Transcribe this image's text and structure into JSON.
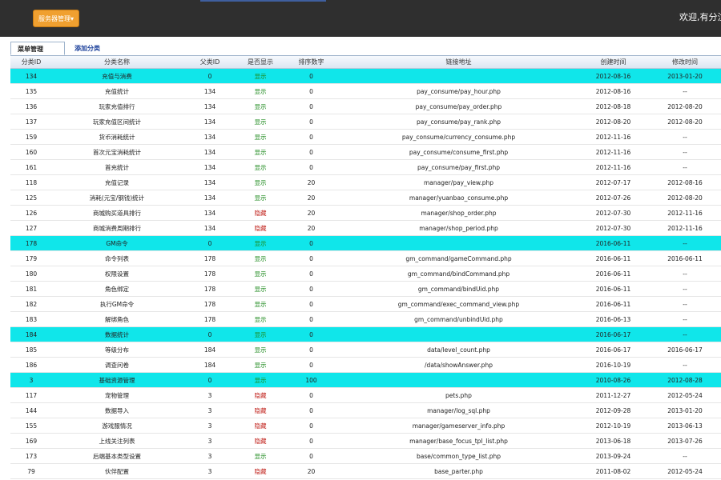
{
  "header": {
    "service_button": "服务器管理▾",
    "welcome": "欢迎,有分泣起"
  },
  "tabs": [
    {
      "label": "菜单管理"
    },
    {
      "label": "添加分类"
    }
  ],
  "columns": [
    "分类ID",
    "分类名称",
    "父类ID",
    "是否显示",
    "排序数字",
    "链接地址",
    "创建时间",
    "修改时间"
  ],
  "rows": [
    {
      "id": "134",
      "name": "充值与消费",
      "parent": "0",
      "visible": "显示",
      "sort": "0",
      "url": "",
      "created": "2012-08-16",
      "modified": "2013-01-20",
      "highlight": true
    },
    {
      "id": "135",
      "name": "充值统计",
      "parent": "134",
      "visible": "显示",
      "sort": "0",
      "url": "pay_consume/pay_hour.php",
      "created": "2012-08-16",
      "modified": "--",
      "highlight": false
    },
    {
      "id": "136",
      "name": "玩家充值排行",
      "parent": "134",
      "visible": "显示",
      "sort": "0",
      "url": "pay_consume/pay_order.php",
      "created": "2012-08-18",
      "modified": "2012-08-20",
      "highlight": false
    },
    {
      "id": "137",
      "name": "玩家充值区间统计",
      "parent": "134",
      "visible": "显示",
      "sort": "0",
      "url": "pay_consume/pay_rank.php",
      "created": "2012-08-20",
      "modified": "2012-08-20",
      "highlight": false
    },
    {
      "id": "159",
      "name": "货币消耗统计",
      "parent": "134",
      "visible": "显示",
      "sort": "0",
      "url": "pay_consume/currency_consume.php",
      "created": "2012-11-16",
      "modified": "--",
      "highlight": false
    },
    {
      "id": "160",
      "name": "首次元宝消耗统计",
      "parent": "134",
      "visible": "显示",
      "sort": "0",
      "url": "pay_consume/consume_first.php",
      "created": "2012-11-16",
      "modified": "--",
      "highlight": false
    },
    {
      "id": "161",
      "name": "首充统计",
      "parent": "134",
      "visible": "显示",
      "sort": "0",
      "url": "pay_consume/pay_first.php",
      "created": "2012-11-16",
      "modified": "--",
      "highlight": false
    },
    {
      "id": "118",
      "name": "充值记录",
      "parent": "134",
      "visible": "显示",
      "sort": "20",
      "url": "manager/pay_view.php",
      "created": "2012-07-17",
      "modified": "2012-08-16",
      "highlight": false
    },
    {
      "id": "125",
      "name": "消耗(元宝/钢钱)统计",
      "parent": "134",
      "visible": "显示",
      "sort": "20",
      "url": "manager/yuanbao_consume.php",
      "created": "2012-07-26",
      "modified": "2012-08-20",
      "highlight": false
    },
    {
      "id": "126",
      "name": "商城购买道具排行",
      "parent": "134",
      "visible": "隐藏",
      "sort": "20",
      "url": "manager/shop_order.php",
      "created": "2012-07-30",
      "modified": "2012-11-16",
      "highlight": false
    },
    {
      "id": "127",
      "name": "商城消费周期排行",
      "parent": "134",
      "visible": "隐藏",
      "sort": "20",
      "url": "manager/shop_period.php",
      "created": "2012-07-30",
      "modified": "2012-11-16",
      "highlight": false
    },
    {
      "id": "178",
      "name": "GM命令",
      "parent": "0",
      "visible": "显示",
      "sort": "0",
      "url": "",
      "created": "2016-06-11",
      "modified": "--",
      "highlight": true
    },
    {
      "id": "179",
      "name": "命令列表",
      "parent": "178",
      "visible": "显示",
      "sort": "0",
      "url": "gm_command/gameCommand.php",
      "created": "2016-06-11",
      "modified": "2016-06-11",
      "highlight": false
    },
    {
      "id": "180",
      "name": "权限设置",
      "parent": "178",
      "visible": "显示",
      "sort": "0",
      "url": "gm_command/bindCommand.php",
      "created": "2016-06-11",
      "modified": "--",
      "highlight": false
    },
    {
      "id": "181",
      "name": "角色绑定",
      "parent": "178",
      "visible": "显示",
      "sort": "0",
      "url": "gm_command/bindUid.php",
      "created": "2016-06-11",
      "modified": "--",
      "highlight": false
    },
    {
      "id": "182",
      "name": "执行GM命令",
      "parent": "178",
      "visible": "显示",
      "sort": "0",
      "url": "gm_command/exec_command_view.php",
      "created": "2016-06-11",
      "modified": "--",
      "highlight": false
    },
    {
      "id": "183",
      "name": "解绑角色",
      "parent": "178",
      "visible": "显示",
      "sort": "0",
      "url": "gm_command/unbindUid.php",
      "created": "2016-06-13",
      "modified": "--",
      "highlight": false
    },
    {
      "id": "184",
      "name": "数据统计",
      "parent": "0",
      "visible": "显示",
      "sort": "0",
      "url": "",
      "created": "2016-06-17",
      "modified": "--",
      "highlight": true
    },
    {
      "id": "185",
      "name": "等级分布",
      "parent": "184",
      "visible": "显示",
      "sort": "0",
      "url": "data/level_count.php",
      "created": "2016-06-17",
      "modified": "2016-06-17",
      "highlight": false
    },
    {
      "id": "186",
      "name": "调查问卷",
      "parent": "184",
      "visible": "显示",
      "sort": "0",
      "url": "/data/showAnswer.php",
      "created": "2016-10-19",
      "modified": "--",
      "highlight": false
    },
    {
      "id": "3",
      "name": "基础资源管理",
      "parent": "0",
      "visible": "显示",
      "sort": "100",
      "url": "",
      "created": "2010-08-26",
      "modified": "2012-08-28",
      "highlight": true
    },
    {
      "id": "117",
      "name": "宠物管理",
      "parent": "3",
      "visible": "隐藏",
      "sort": "0",
      "url": "pets.php",
      "created": "2011-12-27",
      "modified": "2012-05-24",
      "highlight": false
    },
    {
      "id": "144",
      "name": "数据导入",
      "parent": "3",
      "visible": "隐藏",
      "sort": "0",
      "url": "manager/log_sql.php",
      "created": "2012-09-28",
      "modified": "2013-01-20",
      "highlight": false
    },
    {
      "id": "155",
      "name": "游戏服情况",
      "parent": "3",
      "visible": "隐藏",
      "sort": "0",
      "url": "manager/gameserver_info.php",
      "created": "2012-10-19",
      "modified": "2013-06-13",
      "highlight": false
    },
    {
      "id": "169",
      "name": "上线关注列表",
      "parent": "3",
      "visible": "隐藏",
      "sort": "0",
      "url": "manager/base_focus_tpl_list.php",
      "created": "2013-06-18",
      "modified": "2013-07-26",
      "highlight": false
    },
    {
      "id": "173",
      "name": "后端基本类型设置",
      "parent": "3",
      "visible": "显示",
      "sort": "0",
      "url": "base/common_type_list.php",
      "created": "2013-09-24",
      "modified": "--",
      "highlight": false
    },
    {
      "id": "79",
      "name": "伙伴配置",
      "parent": "3",
      "visible": "隐藏",
      "sort": "20",
      "url": "base_parter.php",
      "created": "2011-08-02",
      "modified": "2012-05-24",
      "highlight": false
    }
  ],
  "colors": {
    "topbar": "#2f2f2f",
    "service_button": "#f0a030",
    "highlight_row": "#10e6ea",
    "visible_text": "#1d8a1d",
    "hidden_text": "#c0201a"
  }
}
